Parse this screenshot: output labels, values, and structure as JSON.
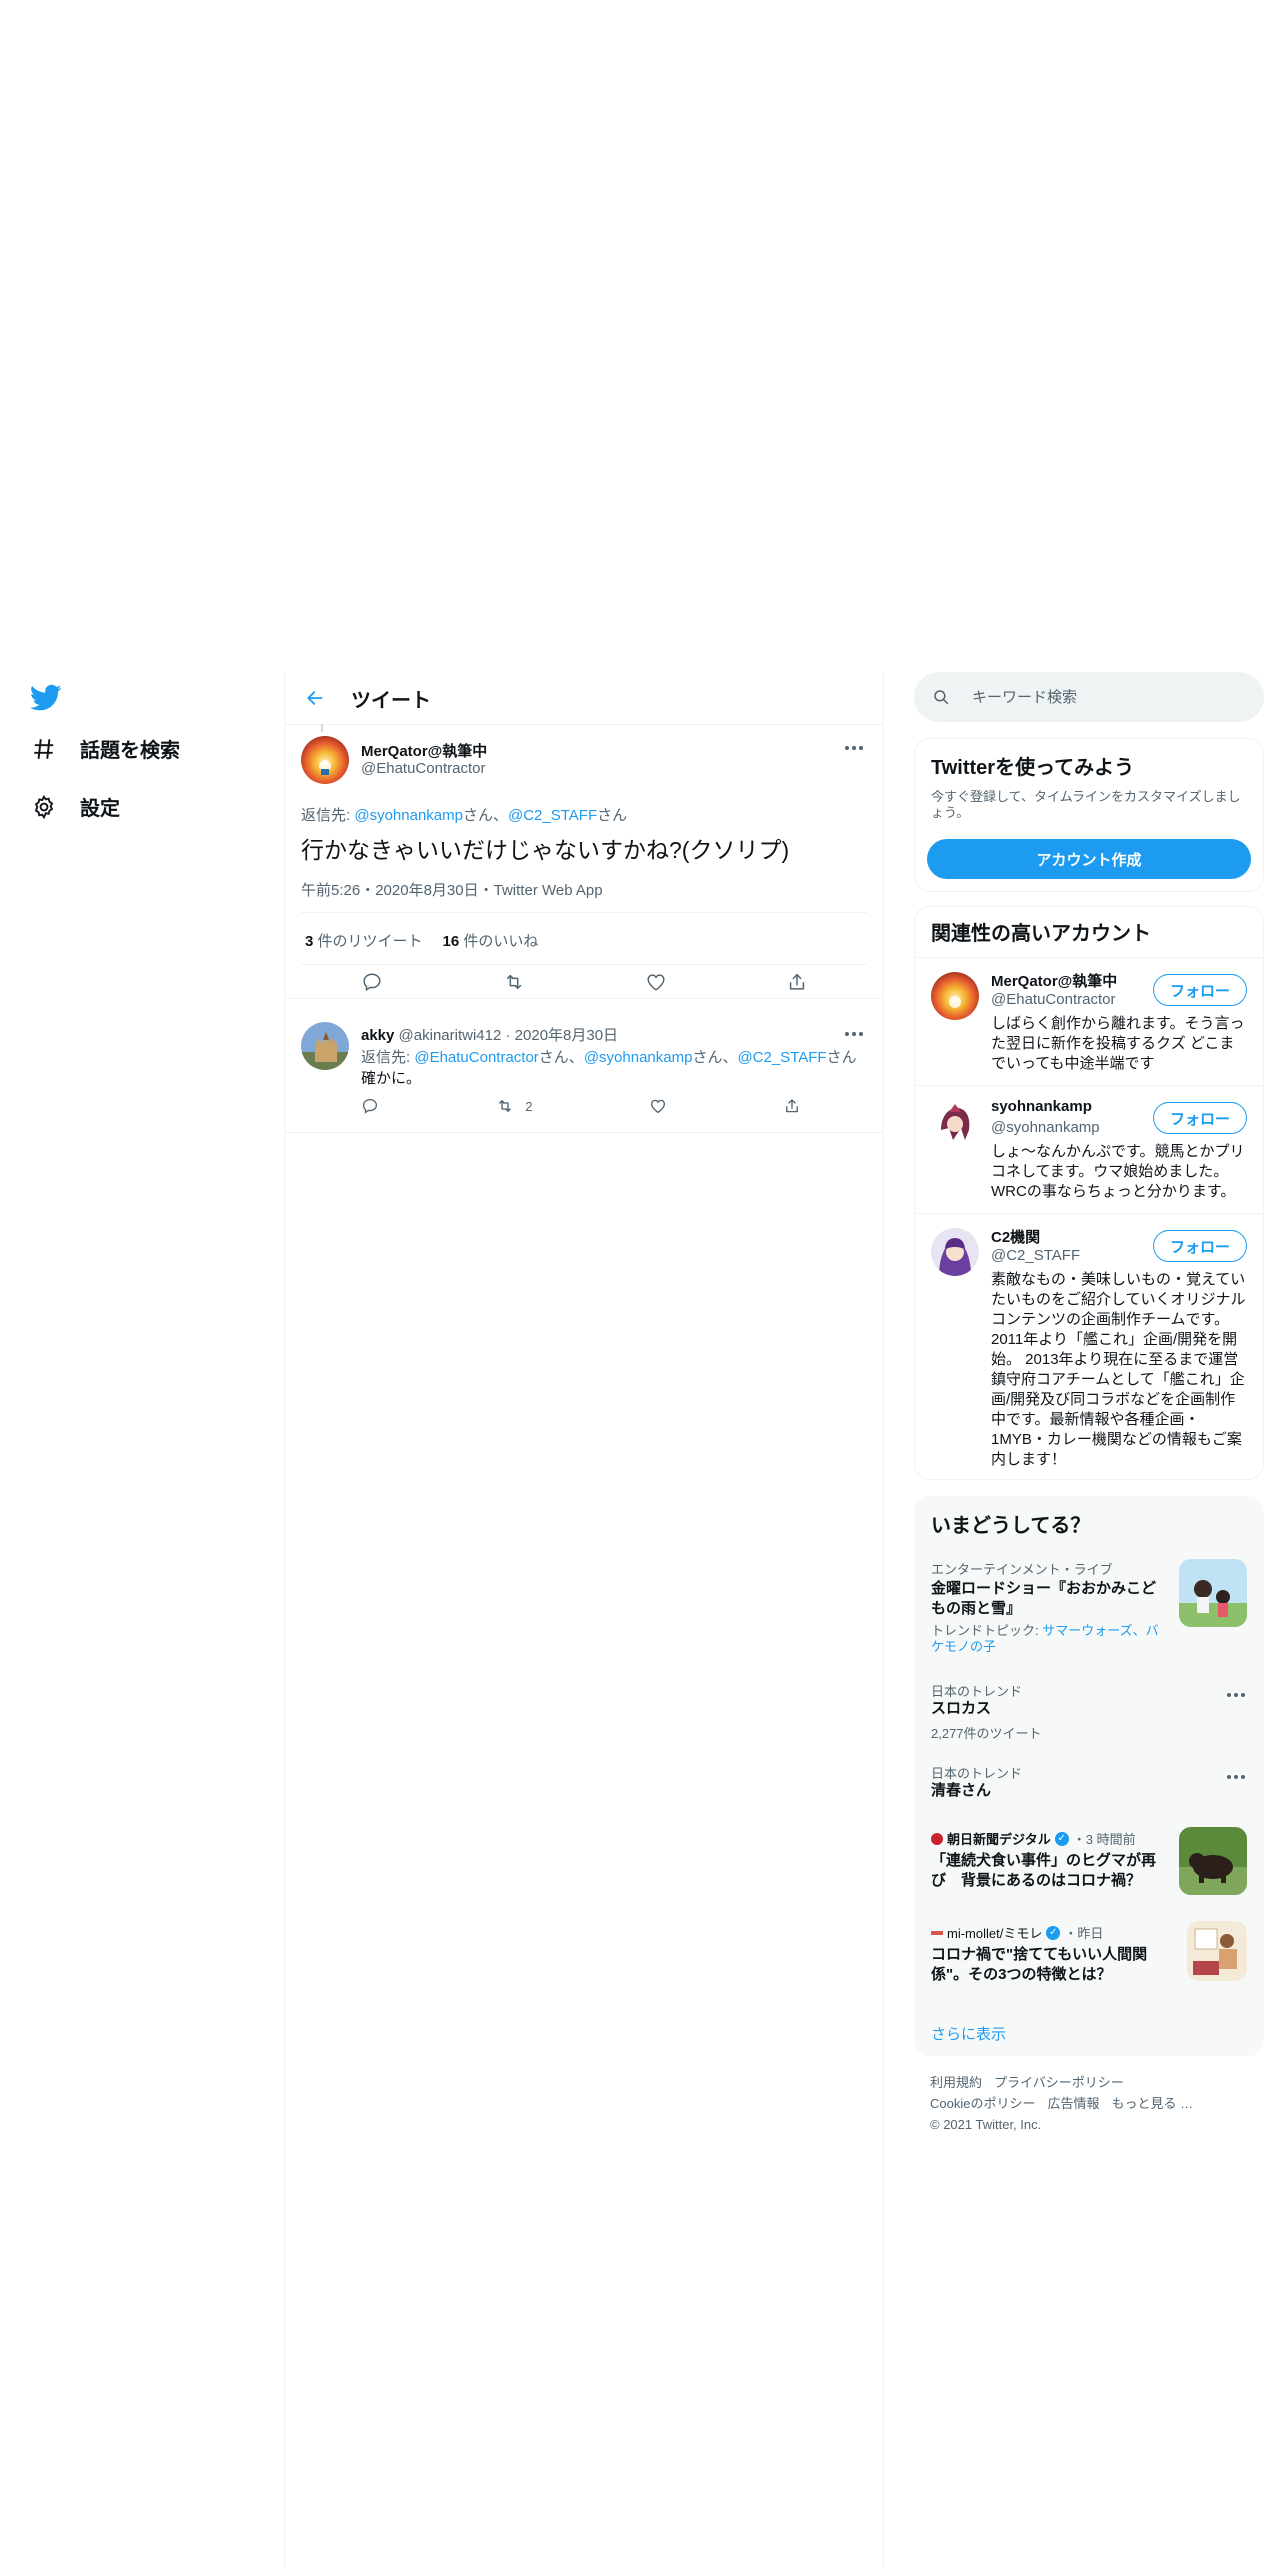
{
  "nav": {
    "explore": "話題を検索",
    "settings": "設定"
  },
  "header": {
    "title": "ツイート"
  },
  "main_tweet": {
    "name": "MerQator@執筆中",
    "handle": "@EhatuContractor",
    "reply_prefix": "返信先: ",
    "reply_user1": "@syohnankamp",
    "reply_mid": "さん、",
    "reply_user2": "@C2_STAFF",
    "reply_suffix": "さん",
    "text": "行かなきゃいいだけじゃないすかね?(クソリプ)",
    "time": "午前5:26",
    "date": "2020年8月30日",
    "source": "Twitter Web App",
    "sep": "・",
    "retweets": "3",
    "retweets_label": "件のリツイート",
    "likes": "16",
    "likes_label": "件のいいね"
  },
  "reply_tweet": {
    "name": "akky",
    "handle": "@akinaritwi412",
    "date": "· 2020年8月30日",
    "reply_prefix": "返信先: ",
    "reply_user1": "@EhatuContractor",
    "reply_mid1": "さん、",
    "reply_user2": "@syohnankamp",
    "reply_mid2": "さん、",
    "reply_user3": "@C2_STAFF",
    "reply_suffix": "さん",
    "text": "確かに。",
    "retweet_count": "2"
  },
  "search": {
    "placeholder": "キーワード検索"
  },
  "signup": {
    "title": "Twitterを使ってみよう",
    "desc": "今すぐ登録して、タイムラインをカスタマイズしましょう。",
    "button": "アカウント作成"
  },
  "relevant": {
    "title": "関連性の高いアカウント",
    "follow_label": "フォロー",
    "accounts": [
      {
        "name": "MerQator@執筆中",
        "handle": "@EhatuContractor",
        "bio": "しばらく創作から離れます。そう言った翌日に新作を投稿するクズ どこまでいっても中途半端です"
      },
      {
        "name": "syohnankamp",
        "handle": "@syohnankamp",
        "bio": "しょ～なんかんぷです。競馬とかプリコネしてます。ウマ娘始めました。WRCの事ならちょっと分かります。"
      },
      {
        "name": "C2機関",
        "handle": "@C2_STAFF",
        "bio": "素敵なもの・美味しいもの・覚えていたいものをご紹介していくオリジナルコンテンツの企画制作チームです。 2011年より「艦これ」企画/開発を開始。 2013年より現在に至るまで運営鎮守府コアチームとして「艦これ」企画/開発及び同コラボなどを企画制作中です。最新情報や各種企画・1MYB・カレー機関などの情報もご案内します！"
      }
    ]
  },
  "trends": {
    "title": "いまどうしてる？",
    "items": [
      {
        "category": "エンターテインメント・ライブ",
        "title": "金曜ロードショー『おおかみこどもの雨と雪』",
        "sub_prefix": "トレンドトピック: ",
        "sub_links": "サマーウォーズ、バケモノの子"
      },
      {
        "category": "日本のトレンド",
        "title": "スロカス",
        "count": "2,277件のツイート"
      },
      {
        "category": "日本のトレンド",
        "title": "清春さん"
      },
      {
        "source": "朝日新聞デジタル",
        "time": "・3 時間前",
        "title": "「連続犬食い事件」のヒグマが再び　背景にあるのはコロナ禍？"
      },
      {
        "source": "mi-mollet/ミモレ",
        "time": "・昨日",
        "title": "コロナ禍で\"捨ててもいい人間関係\"。その3つの特徴とは？"
      }
    ],
    "more": "さらに表示"
  },
  "footer": {
    "terms": "利用規約",
    "privacy": "プライバシーポリシー",
    "cookie": "Cookieのポリシー",
    "ads": "広告情報",
    "more": "もっと見る …",
    "copyright": "© 2021 Twitter, Inc."
  },
  "colors": {
    "accent": "#1d9bf0",
    "text": "#0f1419",
    "muted": "#536471",
    "border": "#eff3f4"
  }
}
